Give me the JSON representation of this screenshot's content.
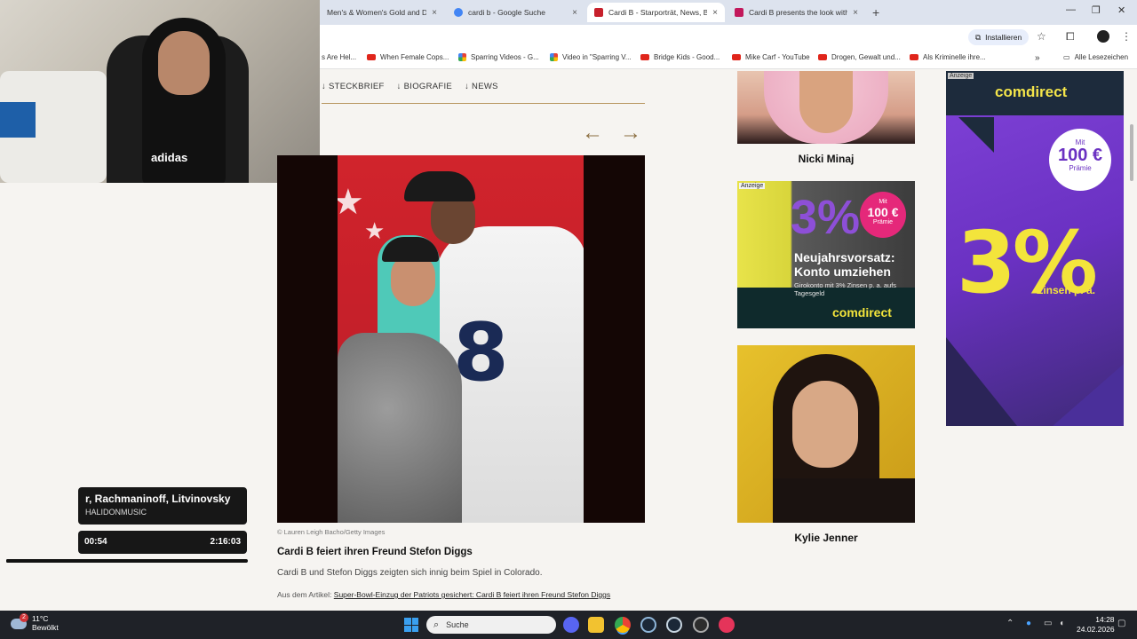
{
  "browser": {
    "tabs": [
      {
        "label": "Men's & Women's Gold and Di",
        "favicon_color": "#d4b44c"
      },
      {
        "label": "cardi b - Google Suche",
        "favicon_color": "#4285f4"
      },
      {
        "label": "Cardi B - Starporträt, News, Bild",
        "favicon_color": "#c7202c"
      },
      {
        "label": "Cardi B presents the look witho",
        "favicon_color": "#c2185b"
      }
    ],
    "install_label": "Installieren",
    "bookmarks": [
      {
        "label": "s Are Hel...",
        "icon": "none"
      },
      {
        "label": "When Female Cops...",
        "icon": "youtube-icon"
      },
      {
        "label": "Sparring Videos - G...",
        "icon": "drive-icon"
      },
      {
        "label": "Video in \"Sparring V...",
        "icon": "drive-icon"
      },
      {
        "label": "Bridge Kids - Good...",
        "icon": "youtube-icon"
      },
      {
        "label": "Mike Carf - YouTube",
        "icon": "youtube-icon"
      },
      {
        "label": "Drogen, Gewalt und...",
        "icon": "youtube-icon"
      },
      {
        "label": "Als Kriminelle ihre...",
        "icon": "youtube-icon"
      }
    ],
    "all_bookmarks": "Alle Lesezeichen"
  },
  "webcam": {
    "shirt_logo": "adidas"
  },
  "subnav": [
    "↓ STECKBRIEF",
    "↓ BIOGRAFIE",
    "↓ NEWS"
  ],
  "gallery": {
    "prev": "←",
    "next": "→",
    "image_number": "8",
    "credit": "© Lauren Leigh Bacho/Getty Images",
    "title": "Cardi B feiert ihren Freund Stefon Diggs",
    "text": "Cardi B und Stefon Diggs zeigten sich innig beim Spiel in Colorado.",
    "from_label": "Aus dem Artikel: ",
    "from_link": "Super-Bowl-Einzug der Patriots gesichert: Cardi B feiert ihren Freund Stefon Diggs"
  },
  "sidebar": {
    "card1_name": "Nicki Minaj",
    "card2_name": "Kylie Jenner",
    "ad_mid": {
      "tag": "Anzeige",
      "pct": "3%",
      "bubble_top": "Mit",
      "bubble_amount": "100 €",
      "bubble_bottom": "Prämie",
      "headline": "Neujahrsvorsatz: Konto umziehen",
      "sub": "Girokonto mit 3% Zinsen p. a. aufs Tagesgeld",
      "brand": "comdirect"
    }
  },
  "ad_right": {
    "tag": "Anzeige",
    "brand": "comdirect",
    "bubble_top": "Mit",
    "bubble_amount": "100 €",
    "bubble_bottom": "Prämie",
    "big": "3%",
    "zins": "Zinsen p. a."
  },
  "music": {
    "title": "r, Rachmaninoff, Litvinovsky",
    "artist": "HALIDONMUSIC",
    "elapsed": "00:54",
    "total": "2:16:03",
    "progress": 0.0066
  },
  "taskbar": {
    "weather_badge": "2",
    "temp": "11°C",
    "condition": "Bewölkt",
    "search_placeholder": "Suche",
    "time": "14:28",
    "date": "24.02.2026"
  }
}
